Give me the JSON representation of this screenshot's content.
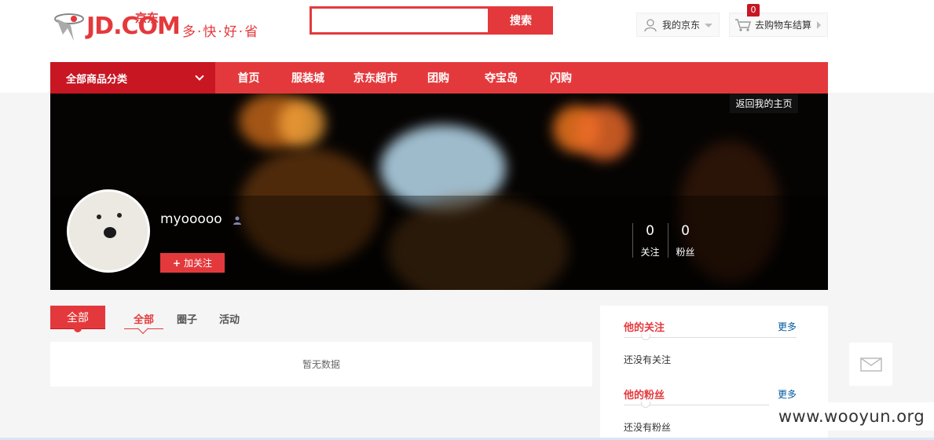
{
  "header": {
    "logo_text": "JD.COM",
    "logo_cn": "京东",
    "slogan": "多·快·好·省",
    "search": {
      "value": "",
      "placeholder": "",
      "button": "搜索"
    },
    "myjd_label": "我的京东",
    "cart_label": "去购物车结算",
    "cart_count": "0"
  },
  "nav": {
    "all_categories": "全部商品分类",
    "items": [
      "首页",
      "服装城",
      "京东超市",
      "团购",
      "夺宝岛",
      "闪购"
    ]
  },
  "profile": {
    "back_home": "返回我的主页",
    "username": "myooooo",
    "follow_button": "加关注",
    "stats": [
      {
        "value": "0",
        "label": "关注"
      },
      {
        "value": "0",
        "label": "粉丝"
      }
    ]
  },
  "tabs": {
    "main": "全部",
    "items": [
      "全部",
      "圈子",
      "活动"
    ],
    "active_index": 0
  },
  "feed": {
    "empty_text": "暂无数据"
  },
  "sidebar": {
    "following": {
      "title": "他的关注",
      "more": "更多",
      "empty": "还没有关注"
    },
    "fans": {
      "title": "他的粉丝",
      "more": "更多",
      "empty": "还没有粉丝"
    }
  },
  "watermark": "www.wooyun.org",
  "colors": {
    "brand_red": "#e4393c",
    "dark_red": "#c81623",
    "link_blue": "#005aa0"
  }
}
